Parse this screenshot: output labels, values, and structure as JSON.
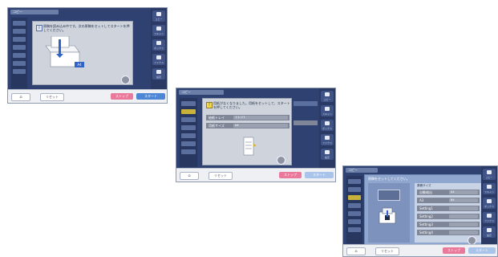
{
  "screens": [
    {
      "title": "コピー",
      "message": "原稿を読み込み中です。次の原稿をセットしてスタートを押してください。",
      "side": [
        "コピー",
        "スキャン",
        "ボックス",
        "ファクス",
        "設定"
      ],
      "bottom": {
        "home": "⌂",
        "reset": "リセット",
        "stop": "ストップ",
        "start": "スタート"
      }
    },
    {
      "title": "コピー",
      "message": "用紙がなくなりました。用紙をセットして、スタートを押してください。",
      "rows": [
        {
          "label": "給紙トレイ",
          "value": "トレイ1"
        },
        {
          "label": "用紙サイズ",
          "value": "A4"
        }
      ],
      "side": [
        "コピー",
        "スキャン",
        "ボックス",
        "ファクス",
        "設定"
      ],
      "bottom": {
        "home": "⌂",
        "reset": "リセット",
        "stop": "ストップ",
        "start": "スタート"
      }
    },
    {
      "title": "コピー",
      "message": "原稿をセットしてください。",
      "panel_title": "原稿サイズ",
      "rows": [
        {
          "label": "自動検出",
          "value": "A4"
        },
        {
          "label": "A3",
          "value": "B4"
        },
        {
          "label": "Setting1",
          "value": ""
        },
        {
          "label": "Setting2",
          "value": ""
        },
        {
          "label": "Setting3",
          "value": ""
        },
        {
          "label": "Setting4",
          "value": ""
        }
      ],
      "side": [
        "コピー",
        "スキャン",
        "ボックス",
        "ファクス",
        "設定"
      ],
      "bottom": {
        "home": "⌂",
        "reset": "リセット",
        "stop": "ストップ",
        "start": "スタート"
      }
    }
  ]
}
